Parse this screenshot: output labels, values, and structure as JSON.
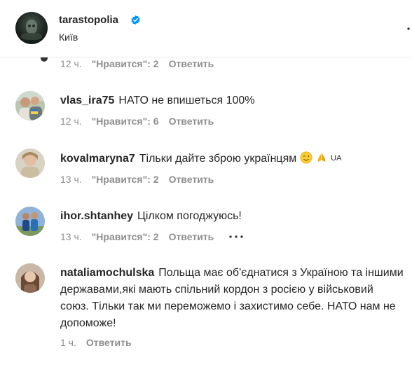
{
  "header": {
    "username": "tarastopolia",
    "location": "Київ"
  },
  "prev_comment_meta": {
    "time": "12 ч.",
    "likes": "\"Нравится\": 2",
    "reply": "Ответить"
  },
  "comments": [
    {
      "username": "vlas_ira75",
      "text": "НАТО не впишеться 100%",
      "time": "12 ч.",
      "likes": "\"Нравится\": 6",
      "reply": "Ответить"
    },
    {
      "username": "kovalmaryna7",
      "text": "Тільки дайте зброю українцям",
      "flag_tag": "UA",
      "time": "13 ч.",
      "likes": "\"Нравится\": 2",
      "reply": "Ответить"
    },
    {
      "username": "ihor.shtanhey",
      "text": "Цілком погоджуюсь!",
      "time": "13 ч.",
      "likes": "\"Нравится\": 2",
      "reply": "Ответить"
    },
    {
      "username": "nataliamochulska",
      "text": "Польща має об'єднатися з Україною та іншими державами,які мають спільний кордон з росією у військовий союз. Тільки так ми переможемо і захистимо себе. НАТО нам не допоможе!",
      "time": "1 ч.",
      "reply": "Ответить"
    }
  ],
  "colors": {
    "verified": "#0095f6",
    "meta_text": "#8e8e8e",
    "body_text": "#262626"
  },
  "icons": [
    "verified-badge-icon",
    "more-options-icon",
    "wink-emoji-icon",
    "praying-hands-emoji-icon",
    "comment-options-icon"
  ]
}
